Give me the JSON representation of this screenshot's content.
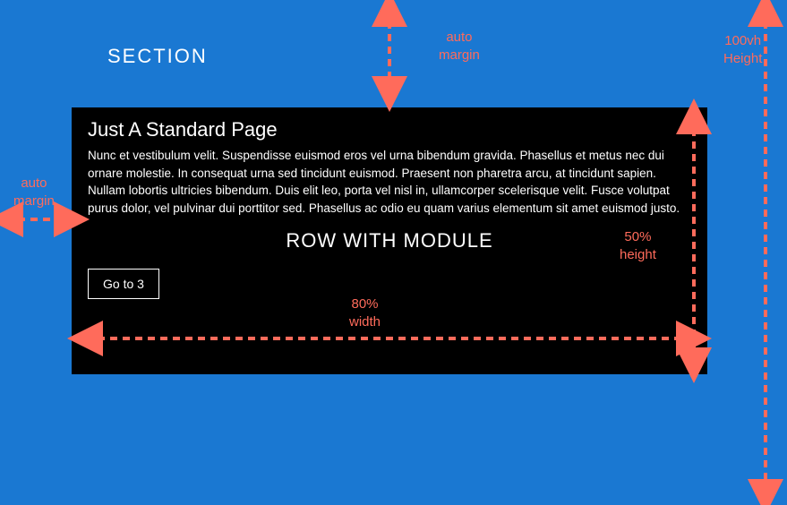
{
  "section_label": "SECTION",
  "module": {
    "heading": "Just A Standard Page",
    "body": "Nunc et vestibulum velit. Suspendisse euismod eros vel urna bibendum gravida. Phasellus et metus nec dui ornare molestie. In consequat urna sed tincidunt euismod. Praesent non pharetra arcu, at tincidunt sapien. Nullam lobortis ultricies bibendum. Duis elit leo, porta vel nisl in, ullamcorper scelerisque velit. Fusce volutpat purus dolor, vel pulvinar dui porttitor sed. Phasellus ac odio eu quam varius elementum sit amet euismod justo.",
    "row_label": "ROW WITH MODULE",
    "button_label": "Go to 3"
  },
  "annotations": {
    "width_label": "80%",
    "width_word": "width",
    "height_label": "50%",
    "height_word": "height",
    "auto_word": "auto",
    "margin_word": "margin",
    "vh_label": "100vh",
    "vh_word": "Height"
  },
  "colors": {
    "section_bg": "#1a78d2",
    "module_bg": "#000000",
    "annotation": "#ff6b5b"
  }
}
